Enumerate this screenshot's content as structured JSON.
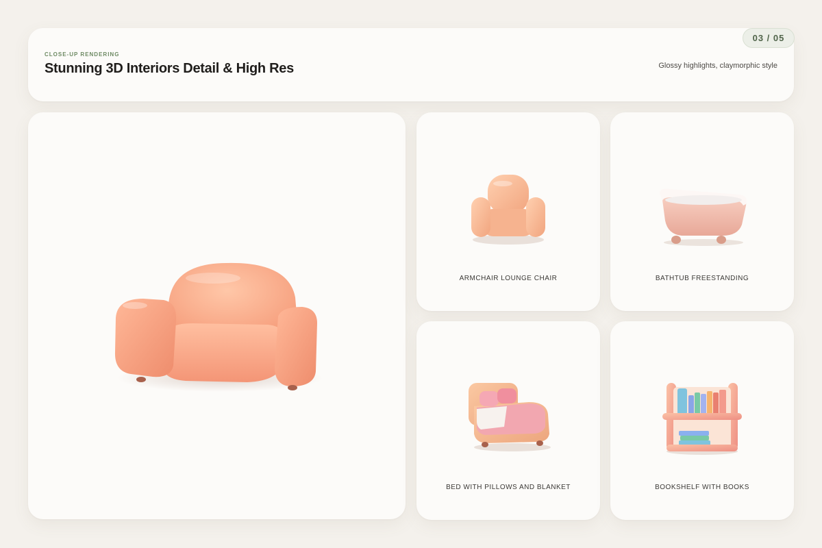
{
  "header": {
    "eyebrow": "CLOSE-UP RENDERING",
    "title": "Stunning 3D Interiors Detail & High Res",
    "subtitle": "Glossy highlights, claymorphic style",
    "page_indicator": "03 / 05"
  },
  "tiles": [
    {
      "label": "ARMCHAIR LOUNGE CHAIR",
      "icon": "armchair-icon"
    },
    {
      "label": "BATHTUB FREESTANDING",
      "icon": "bathtub-icon"
    },
    {
      "label": "BED WITH PILLOWS AND BLANKET",
      "icon": "bed-icon"
    },
    {
      "label": "BOOKSHELF WITH BOOKS",
      "icon": "bookshelf-icon"
    }
  ],
  "hero": {
    "icon": "sofa-icon"
  },
  "colors": {
    "background": "#f4f1ec",
    "card": "#fcfbf9",
    "accent": "#6d8a63",
    "peach": "#f7a98a"
  }
}
